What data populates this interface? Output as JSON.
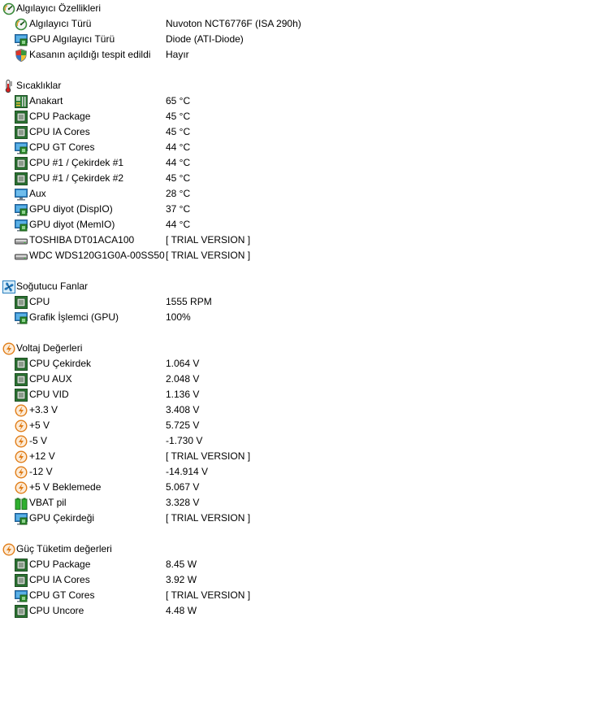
{
  "sections": [
    {
      "title": "Algılayıcı Özellikleri",
      "icon": "sensor-gauge-icon",
      "items": [
        {
          "label": "Algılayıcı Türü",
          "value": "Nuvoton NCT6776F  (ISA 290h)",
          "icon": "sensor-gauge-icon"
        },
        {
          "label": "GPU Algılayıcı Türü",
          "value": "Diode  (ATI-Diode)",
          "icon": "gpu-monitor-icon"
        },
        {
          "label": "Kasanın açıldığı tespit edildi",
          "value": "Hayır",
          "icon": "shield-icon"
        }
      ]
    },
    {
      "title": "Sıcaklıklar",
      "icon": "thermometer-icon",
      "items": [
        {
          "label": "Anakart",
          "value": "65 °C",
          "icon": "motherboard-icon"
        },
        {
          "label": "CPU Package",
          "value": "45 °C",
          "icon": "cpu-chip-icon"
        },
        {
          "label": "CPU IA Cores",
          "value": "45 °C",
          "icon": "cpu-chip-icon"
        },
        {
          "label": "CPU GT Cores",
          "value": "44 °C",
          "icon": "gpu-monitor-icon"
        },
        {
          "label": "CPU #1 / Çekirdek #1",
          "value": "44 °C",
          "icon": "cpu-chip-icon"
        },
        {
          "label": "CPU #1 / Çekirdek #2",
          "value": "45 °C",
          "icon": "cpu-chip-icon"
        },
        {
          "label": "Aux",
          "value": "28 °C",
          "icon": "monitor-icon"
        },
        {
          "label": "GPU diyot (DispIO)",
          "value": "37 °C",
          "icon": "gpu-monitor-icon"
        },
        {
          "label": "GPU diyot (MemIO)",
          "value": "44 °C",
          "icon": "gpu-monitor-icon"
        },
        {
          "label": "TOSHIBA DT01ACA100",
          "value": "[ TRIAL VERSION ]",
          "icon": "hard-drive-icon"
        },
        {
          "label": "WDC WDS120G1G0A-00SS50",
          "value": "[ TRIAL VERSION ]",
          "icon": "hard-drive-icon"
        }
      ]
    },
    {
      "title": "Soğutucu Fanlar",
      "icon": "fan-icon",
      "items": [
        {
          "label": "CPU",
          "value": "1555 RPM",
          "icon": "cpu-chip-icon"
        },
        {
          "label": "Grafik İşlemci (GPU)",
          "value": "100%",
          "icon": "gpu-monitor-icon"
        }
      ]
    },
    {
      "title": "Voltaj Değerleri",
      "icon": "lightning-icon",
      "items": [
        {
          "label": "CPU Çekirdek",
          "value": "1.064 V",
          "icon": "cpu-chip-icon"
        },
        {
          "label": "CPU AUX",
          "value": "2.048 V",
          "icon": "cpu-chip-icon"
        },
        {
          "label": "CPU VID",
          "value": "1.136 V",
          "icon": "cpu-chip-icon"
        },
        {
          "label": "+3.3 V",
          "value": "3.408 V",
          "icon": "lightning-icon"
        },
        {
          "label": "+5 V",
          "value": "5.725 V",
          "icon": "lightning-icon"
        },
        {
          "label": "-5 V",
          "value": "-1.730 V",
          "icon": "lightning-icon"
        },
        {
          "label": "+12 V",
          "value": "[ TRIAL VERSION ]",
          "icon": "lightning-icon"
        },
        {
          "label": "-12 V",
          "value": "-14.914 V",
          "icon": "lightning-icon"
        },
        {
          "label": "+5 V Beklemede",
          "value": "5.067 V",
          "icon": "lightning-icon"
        },
        {
          "label": "VBAT pil",
          "value": "3.328 V",
          "icon": "battery-icon"
        },
        {
          "label": "GPU Çekirdeği",
          "value": "[ TRIAL VERSION ]",
          "icon": "gpu-monitor-icon"
        }
      ]
    },
    {
      "title": "Güç Tüketim değerleri",
      "icon": "lightning-icon",
      "items": [
        {
          "label": "CPU Package",
          "value": "8.45 W",
          "icon": "cpu-chip-icon"
        },
        {
          "label": "CPU IA Cores",
          "value": "3.92 W",
          "icon": "cpu-chip-icon"
        },
        {
          "label": "CPU GT Cores",
          "value": "[ TRIAL VERSION ]",
          "icon": "gpu-monitor-icon"
        },
        {
          "label": "CPU Uncore",
          "value": "4.48 W",
          "icon": "cpu-chip-icon"
        }
      ]
    }
  ]
}
